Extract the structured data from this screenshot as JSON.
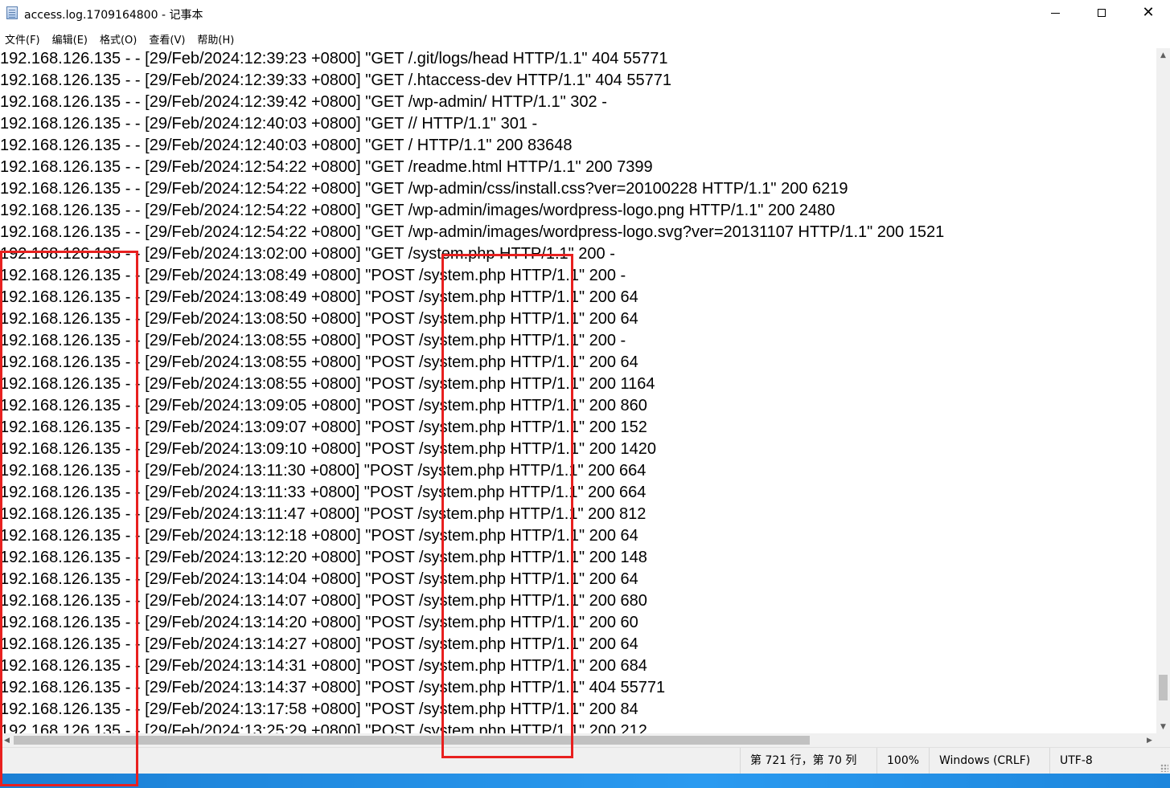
{
  "window": {
    "title": "access.log.1709164800 - 记事本",
    "minimize_glyph": "",
    "close_glyph": "✕"
  },
  "menu": [
    "文件(F)",
    "编辑(E)",
    "格式(O)",
    "查看(V)",
    "帮助(H)"
  ],
  "log_lines": [
    "192.168.126.135 - - [29/Feb/2024:12:39:23 +0800] \"GET /.git/logs/head HTTP/1.1\" 404 55771",
    "192.168.126.135 - - [29/Feb/2024:12:39:33 +0800] \"GET /.htaccess-dev HTTP/1.1\" 404 55771",
    "192.168.126.135 - - [29/Feb/2024:12:39:42 +0800] \"GET /wp-admin/ HTTP/1.1\" 302 -",
    "192.168.126.135 - - [29/Feb/2024:12:40:03 +0800] \"GET // HTTP/1.1\" 301 -",
    "192.168.126.135 - - [29/Feb/2024:12:40:03 +0800] \"GET / HTTP/1.1\" 200 83648",
    "192.168.126.135 - - [29/Feb/2024:12:54:22 +0800] \"GET /readme.html HTTP/1.1\" 200 7399",
    "192.168.126.135 - - [29/Feb/2024:12:54:22 +0800] \"GET /wp-admin/css/install.css?ver=20100228 HTTP/1.1\" 200 6219",
    "192.168.126.135 - - [29/Feb/2024:12:54:22 +0800] \"GET /wp-admin/images/wordpress-logo.png HTTP/1.1\" 200 2480",
    "192.168.126.135 - - [29/Feb/2024:12:54:22 +0800] \"GET /wp-admin/images/wordpress-logo.svg?ver=20131107 HTTP/1.1\" 200 1521",
    "192.168.126.135 - - [29/Feb/2024:13:02:00 +0800] \"GET /system.php HTTP/1.1\" 200 -",
    "192.168.126.135 - - [29/Feb/2024:13:08:49 +0800] \"POST /system.php HTTP/1.1\" 200 -",
    "192.168.126.135 - - [29/Feb/2024:13:08:49 +0800] \"POST /system.php HTTP/1.1\" 200 64",
    "192.168.126.135 - - [29/Feb/2024:13:08:50 +0800] \"POST /system.php HTTP/1.1\" 200 64",
    "192.168.126.135 - - [29/Feb/2024:13:08:55 +0800] \"POST /system.php HTTP/1.1\" 200 -",
    "192.168.126.135 - - [29/Feb/2024:13:08:55 +0800] \"POST /system.php HTTP/1.1\" 200 64",
    "192.168.126.135 - - [29/Feb/2024:13:08:55 +0800] \"POST /system.php HTTP/1.1\" 200 1164",
    "192.168.126.135 - - [29/Feb/2024:13:09:05 +0800] \"POST /system.php HTTP/1.1\" 200 860",
    "192.168.126.135 - - [29/Feb/2024:13:09:07 +0800] \"POST /system.php HTTP/1.1\" 200 152",
    "192.168.126.135 - - [29/Feb/2024:13:09:10 +0800] \"POST /system.php HTTP/1.1\" 200 1420",
    "192.168.126.135 - - [29/Feb/2024:13:11:30 +0800] \"POST /system.php HTTP/1.1\" 200 664",
    "192.168.126.135 - - [29/Feb/2024:13:11:33 +0800] \"POST /system.php HTTP/1.1\" 200 664",
    "192.168.126.135 - - [29/Feb/2024:13:11:47 +0800] \"POST /system.php HTTP/1.1\" 200 812",
    "192.168.126.135 - - [29/Feb/2024:13:12:18 +0800] \"POST /system.php HTTP/1.1\" 200 64",
    "192.168.126.135 - - [29/Feb/2024:13:12:20 +0800] \"POST /system.php HTTP/1.1\" 200 148",
    "192.168.126.135 - - [29/Feb/2024:13:14:04 +0800] \"POST /system.php HTTP/1.1\" 200 64",
    "192.168.126.135 - - [29/Feb/2024:13:14:07 +0800] \"POST /system.php HTTP/1.1\" 200 680",
    "192.168.126.135 - - [29/Feb/2024:13:14:20 +0800] \"POST /system.php HTTP/1.1\" 200 60",
    "192.168.126.135 - - [29/Feb/2024:13:14:27 +0800] \"POST /system.php HTTP/1.1\" 200 64",
    "192.168.126.135 - - [29/Feb/2024:13:14:31 +0800] \"POST /system.php HTTP/1.1\" 200 684",
    "192.168.126.135 - - [29/Feb/2024:13:14:37 +0800] \"POST /system.php HTTP/1.1\" 404 55771",
    "192.168.126.135 - - [29/Feb/2024:13:17:58 +0800] \"POST /system.php HTTP/1.1\" 200 84",
    "192.168.126.135 - - [29/Feb/2024:13:25:29 +0800] \"POST /system.php HTTP/1.1\" 200 212"
  ],
  "status": {
    "position": "第 721 行，第 70 列",
    "zoom": "100%",
    "line_ending": "Windows (CRLF)",
    "encoding": "UTF-8"
  },
  "colors": {
    "highlight": "#e8201f",
    "taskbar": "#1b7fd4"
  }
}
